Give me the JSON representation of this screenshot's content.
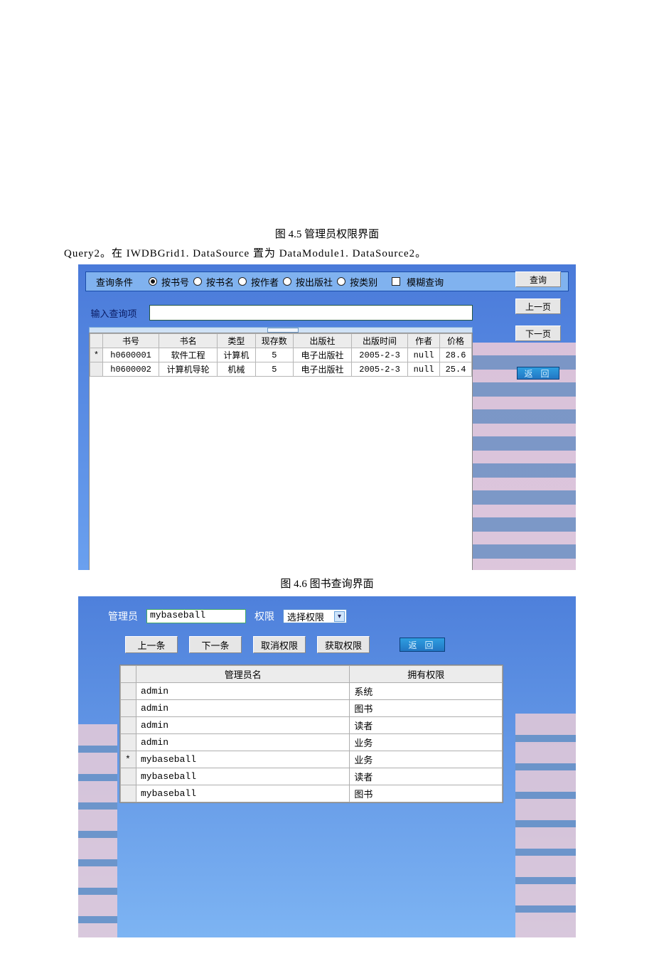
{
  "captions": {
    "fig45": "图 4.5  管理员权限界面",
    "fig46": "图 4.6  图书查询界面"
  },
  "body_line": "Query2。在 IWDBGrid1. DataSource 置为 DataModule1. DataSource2。",
  "query_panel": {
    "cond_label": "查询条件",
    "radios": [
      "按书号",
      "按书名",
      "按作者",
      "按出版社",
      "按类别"
    ],
    "selected_radio_index": 0,
    "fuzzy_label": "模糊查询",
    "input_label": "输入查询项",
    "btn_query": "查询",
    "btn_prev_page": "上一页",
    "btn_next_page": "下一页",
    "btn_back": "返 回",
    "columns": [
      "书号",
      "书名",
      "类型",
      "现存数",
      "出版社",
      "出版时间",
      "作者",
      "价格"
    ],
    "rows": [
      {
        "mark": "*",
        "cells": [
          "h0600001",
          "软件工程",
          "计算机",
          "5",
          "电子出版社",
          "2005-2-3",
          "null",
          "28.6"
        ]
      },
      {
        "mark": "",
        "cells": [
          "h0600002",
          "计算机导轮",
          "机械",
          "5",
          "电子出版社",
          "2005-2-3",
          "null",
          "25.4"
        ]
      }
    ]
  },
  "perm_panel": {
    "label_admin": "管理员",
    "admin_value": "mybaseball",
    "label_perm": "权限",
    "select_text": "选择权限",
    "btn_prev": "上一条",
    "btn_next": "下一条",
    "btn_revoke": "取消权限",
    "btn_grant": "获取权限",
    "btn_back": "返 回",
    "columns": [
      "管理员名",
      "拥有权限"
    ],
    "rows": [
      {
        "mark": "",
        "cells": [
          "admin",
          "系统"
        ]
      },
      {
        "mark": "",
        "cells": [
          "admin",
          "图书"
        ]
      },
      {
        "mark": "",
        "cells": [
          "admin",
          "读者"
        ]
      },
      {
        "mark": "",
        "cells": [
          "admin",
          "业务"
        ]
      },
      {
        "mark": "*",
        "cells": [
          "mybaseball",
          "业务"
        ]
      },
      {
        "mark": "",
        "cells": [
          "mybaseball",
          "读者"
        ]
      },
      {
        "mark": "",
        "cells": [
          "mybaseball",
          "图书"
        ]
      }
    ]
  }
}
